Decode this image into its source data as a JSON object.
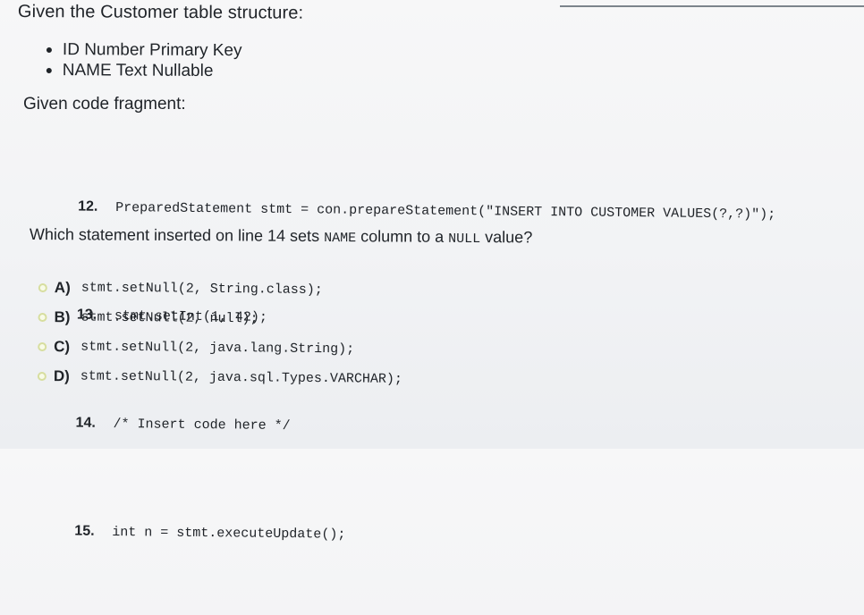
{
  "question": {
    "intro": "Given the Customer table structure:",
    "table_structure": [
      "ID Number Primary Key",
      "NAME Text  Nullable"
    ],
    "fragment_title": "Given code fragment:",
    "code_lines": [
      {
        "number": "12.",
        "text": "PreparedStatement stmt = con.prepareStatement(\"INSERT INTO CUSTOMER VALUES(?,?)\");"
      },
      {
        "number": "13.",
        "text": "stmt.setInt(1, 42);"
      },
      {
        "number": "14.",
        "text": "/* Insert code here */"
      },
      {
        "number": "15.",
        "text": "int n = stmt.executeUpdate();"
      }
    ],
    "prompt_parts": [
      "Which statement inserted on line 14 sets ",
      "NAME",
      " column to a ",
      "NULL",
      " value?"
    ]
  },
  "options": [
    {
      "letter": "A)",
      "code": "stmt.setNull(2, String.class);"
    },
    {
      "letter": "B)",
      "code": "stmt.setNull(2, null);"
    },
    {
      "letter": "C)",
      "code": "stmt.setNull(2, java.lang.String);"
    },
    {
      "letter": "D)",
      "code": "stmt.setNull(2, java.sql.Types.VARCHAR);"
    }
  ]
}
